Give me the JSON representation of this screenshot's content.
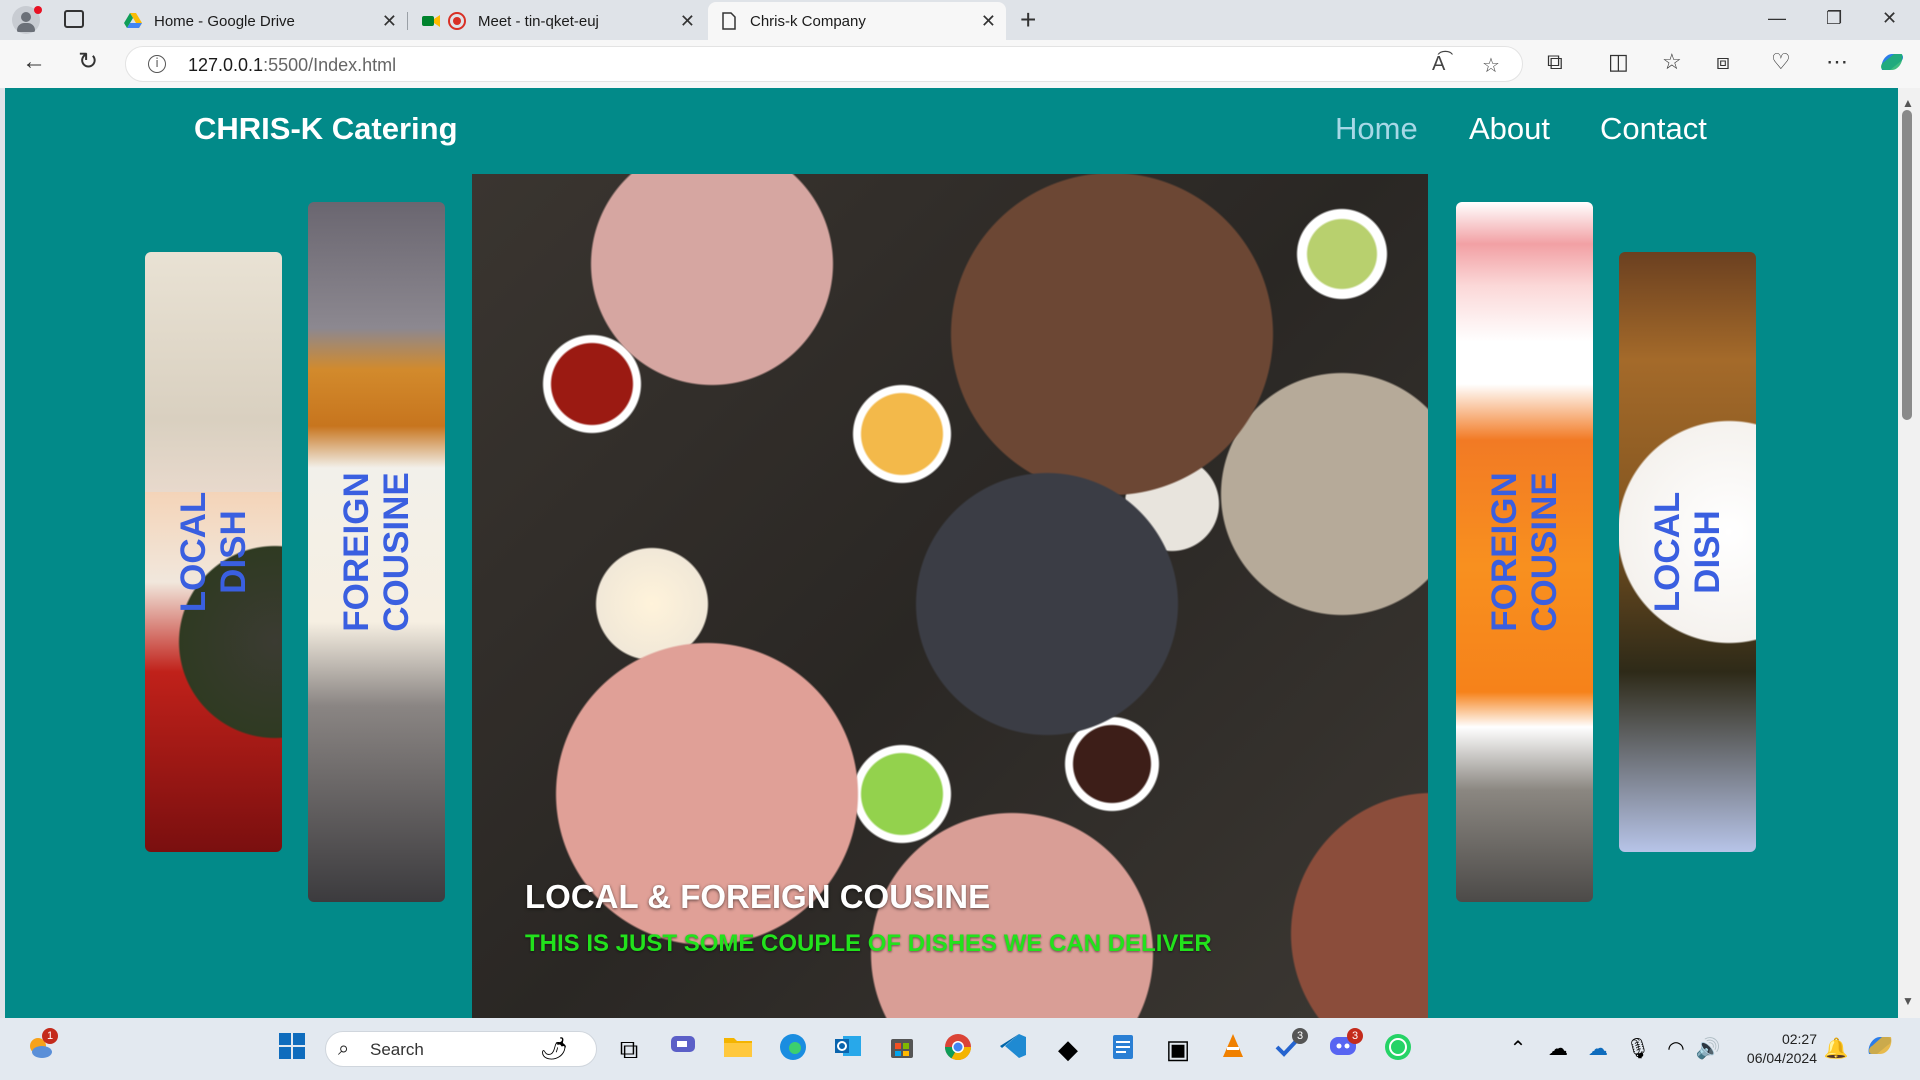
{
  "browser": {
    "tabs": [
      {
        "title": "Home - Google Drive"
      },
      {
        "title": "Meet - tin-qket-euj"
      },
      {
        "title": "Chris-k Company"
      }
    ],
    "url_host": "127.0.0.1",
    "url_rest": ":5500/Index.html"
  },
  "site": {
    "brand": "CHRIS-K Catering",
    "nav": {
      "home": "Home",
      "about": "About",
      "contact": "Contact"
    },
    "hero": {
      "title": "LOCAL & FOREIGN COUSINE",
      "subtitle": "THIS IS JUST SOME COUPLE OF DISHES WE CAN DELIVER"
    },
    "cards": {
      "local_1": {
        "line1": "LOCAL",
        "line2": "DISH"
      },
      "foreign_1": {
        "line1": "FOREIGN",
        "line2": "COUSINE"
      },
      "foreign_2": {
        "line1": "FOREIGN",
        "line2": "COUSINE"
      },
      "local_2": {
        "line1": "LOCAL",
        "line2": "DISH"
      }
    }
  },
  "taskbar": {
    "search_label": "Search",
    "time": "02:27",
    "date": "06/04/2024",
    "badges": {
      "weather": "1",
      "todo": "3",
      "discord": "3"
    }
  },
  "colors": {
    "page_bg": "#028a89",
    "nav_active": "#a7d8e6",
    "card_label": "#3a5fe0",
    "hero_subtitle": "#22e21c"
  }
}
